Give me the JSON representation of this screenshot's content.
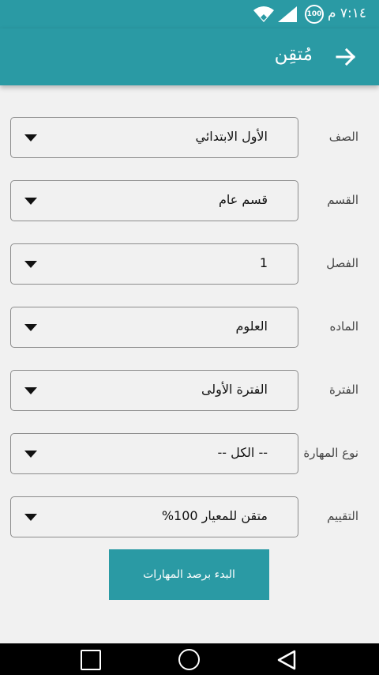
{
  "status_bar": {
    "time": "٧:١٤ م",
    "battery": "100",
    "icons": [
      "wifi-icon",
      "signal-icon",
      "battery-icon"
    ]
  },
  "app_bar": {
    "title": "مُتقِن",
    "back_icon": "arrow-right-icon"
  },
  "form": {
    "rows": [
      {
        "label": "الصف",
        "value": "الأول الابتدائي"
      },
      {
        "label": "القسم",
        "value": "قسم عام"
      },
      {
        "label": "الفصل",
        "value": "1"
      },
      {
        "label": "الماده",
        "value": "العلوم"
      },
      {
        "label": "الفترة",
        "value": "الفترة الأولى"
      },
      {
        "label": "نوع المهارة",
        "value": "-- الكل --"
      },
      {
        "label": "التقييم",
        "value": "متقن للمعيار 100%"
      }
    ]
  },
  "start_button": {
    "label": "البدء برصد المهارات"
  },
  "colors": {
    "primary": "#2a9aa4",
    "background": "#f1f1f1",
    "nav_bar": "#000000"
  },
  "nav_bar": {
    "icons": [
      "recent-apps-icon",
      "home-icon",
      "back-icon"
    ]
  }
}
